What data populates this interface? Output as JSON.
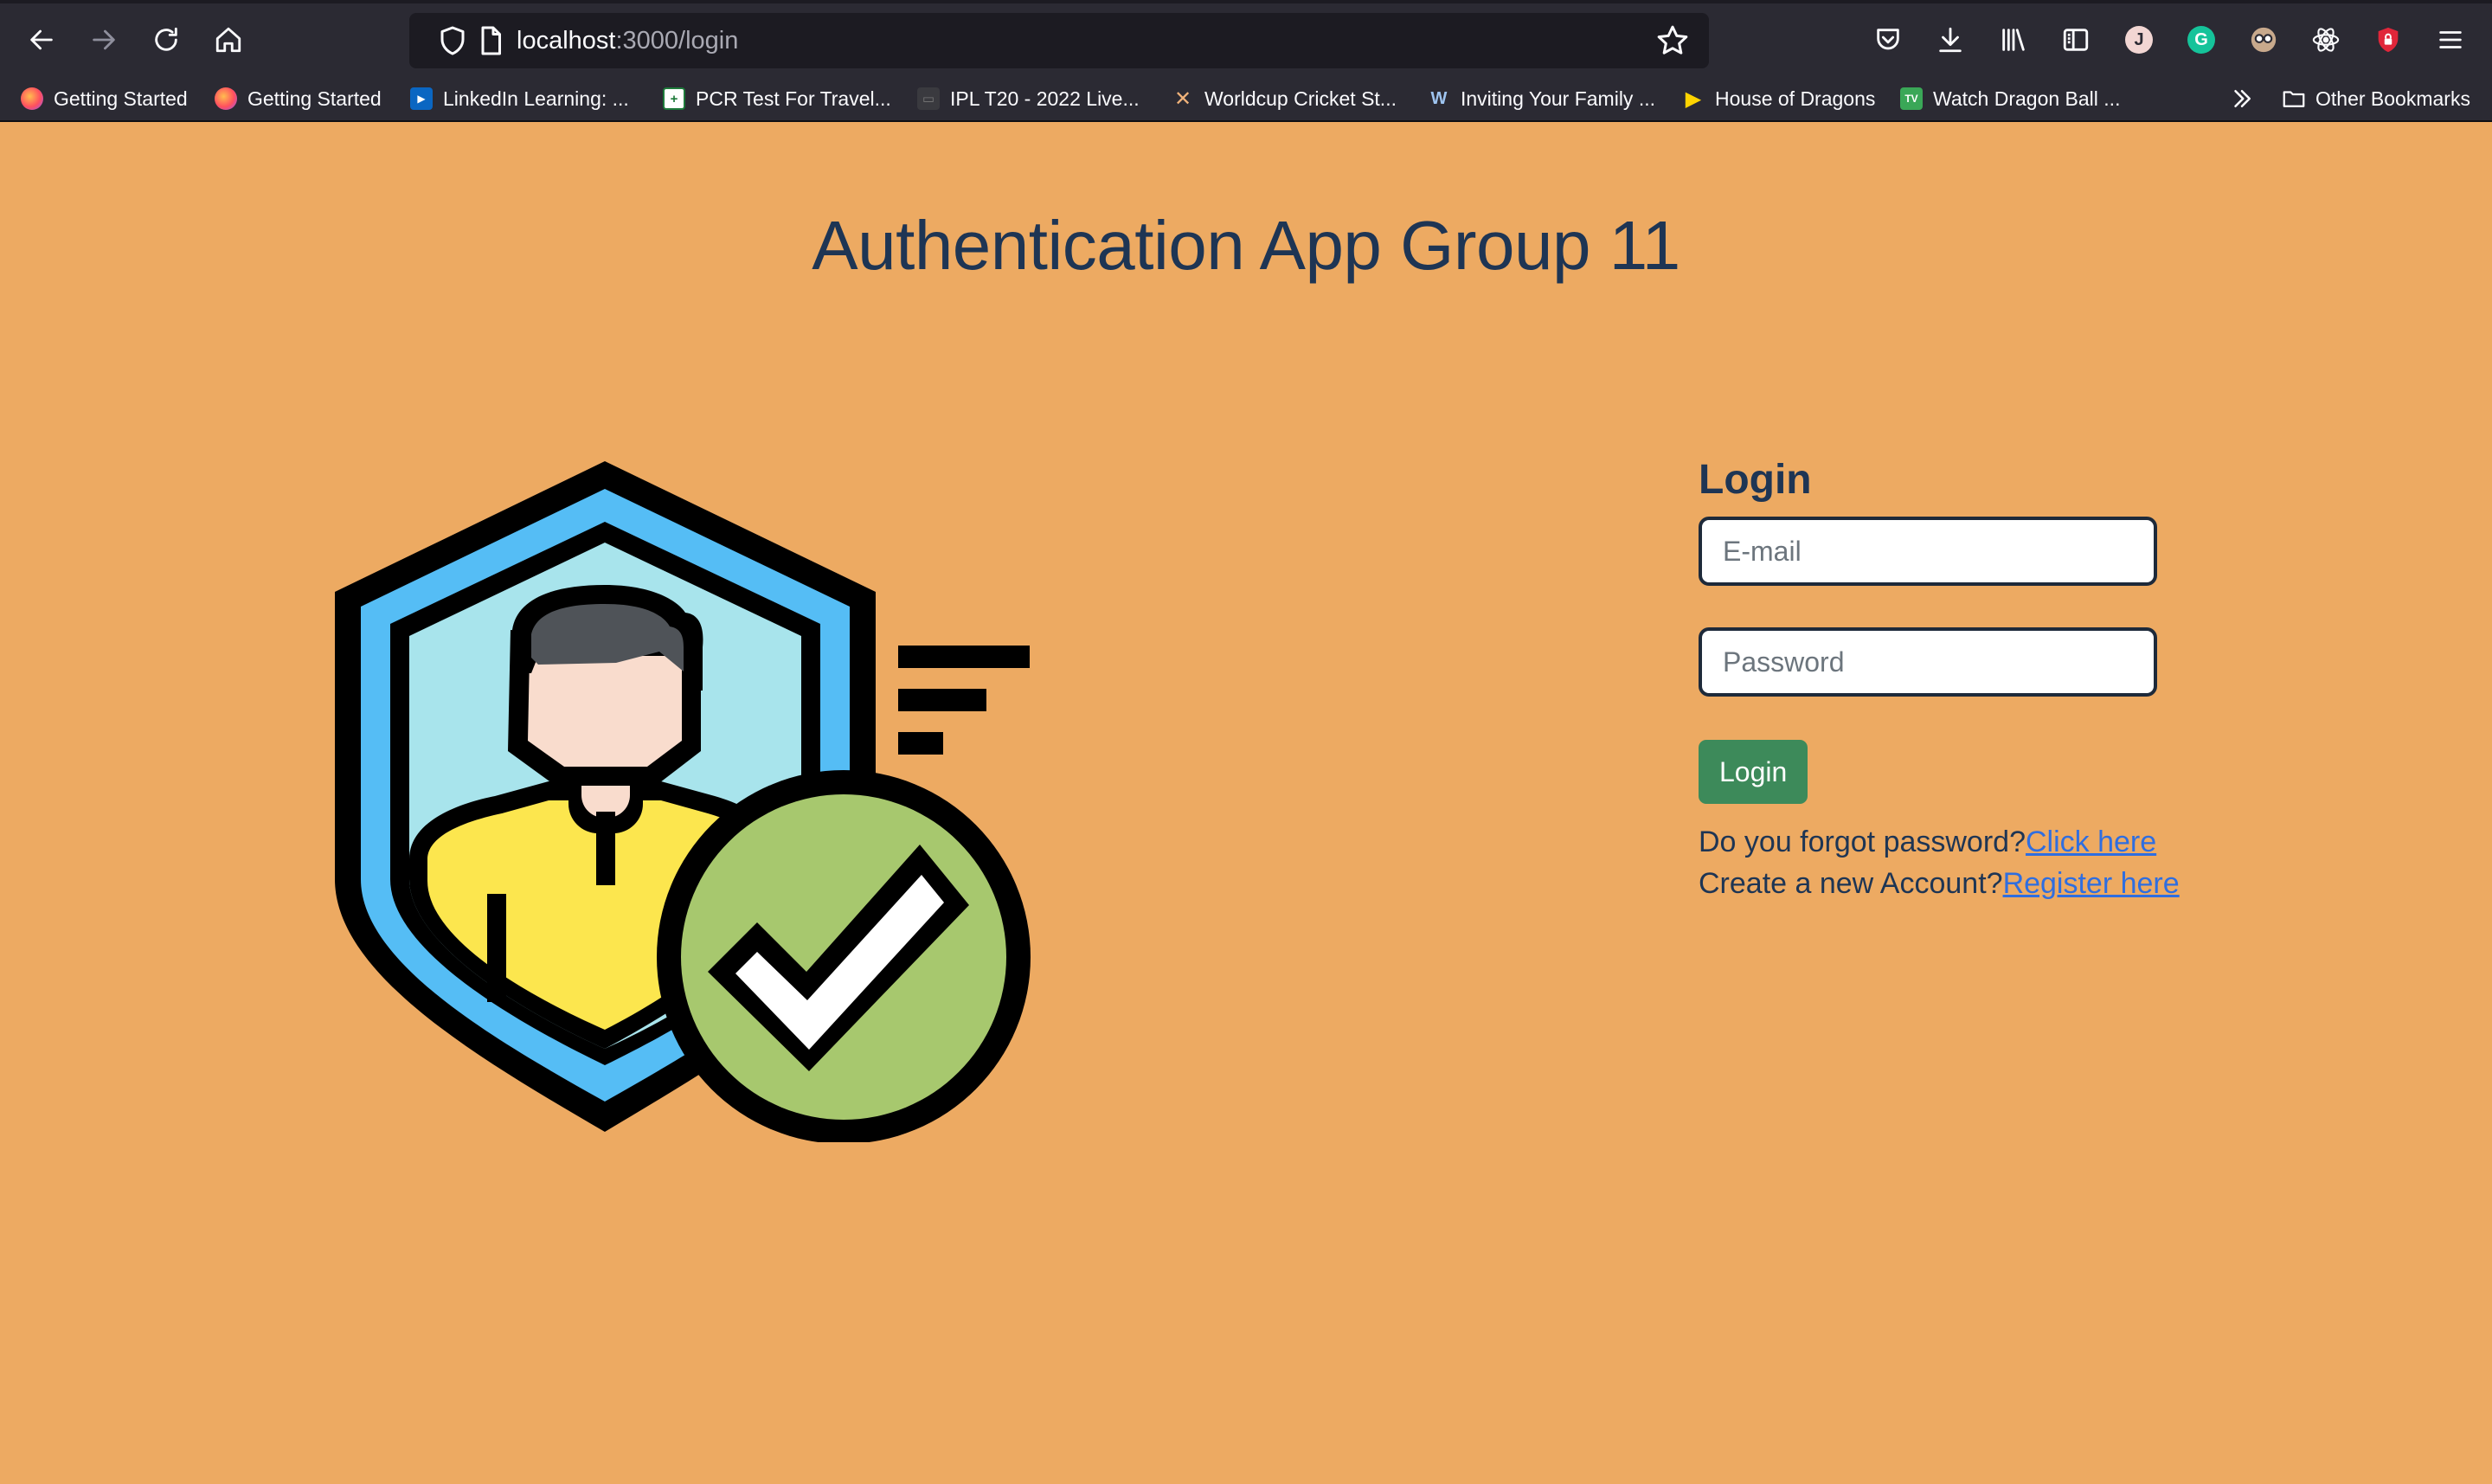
{
  "browser": {
    "url_host": "localhost",
    "url_path": ":3000/login",
    "profile_initial": "J",
    "grammarly_initial": "G"
  },
  "bookmarks": [
    {
      "label": "Getting Started",
      "icon": "firefox-icon"
    },
    {
      "label": "Getting Started",
      "icon": "firefox-icon"
    },
    {
      "label": "LinkedIn Learning: ...",
      "icon": "linkedin-learning-icon"
    },
    {
      "label": "PCR Test For Travel...",
      "icon": "clinic-icon"
    },
    {
      "label": "IPL T20 - 2022 Live...",
      "icon": "tv-icon"
    },
    {
      "label": "Worldcup Cricket St...",
      "icon": "cricket-bats-icon"
    },
    {
      "label": "Inviting Your Family ...",
      "icon": "w-logo-icon"
    },
    {
      "label": "House of Dragons",
      "icon": "play-icon"
    },
    {
      "label": "Watch Dragon Ball ...",
      "icon": "tv-badge-icon"
    }
  ],
  "other_bookmarks_label": "Other Bookmarks",
  "page": {
    "title": "Authentication App Group 11"
  },
  "login": {
    "heading": "Login",
    "email_placeholder": "E-mail",
    "password_placeholder": "Password",
    "button_label": "Login",
    "forgot_text": "Do you forgot password?",
    "forgot_link": "Click here",
    "register_text": "Create a new Account?",
    "register_link": "Register here"
  },
  "colors": {
    "page_background": "#edaa62",
    "title_color": "#1e3554",
    "button_green": "#3d8a5a",
    "link_blue": "#2f6ee0"
  }
}
